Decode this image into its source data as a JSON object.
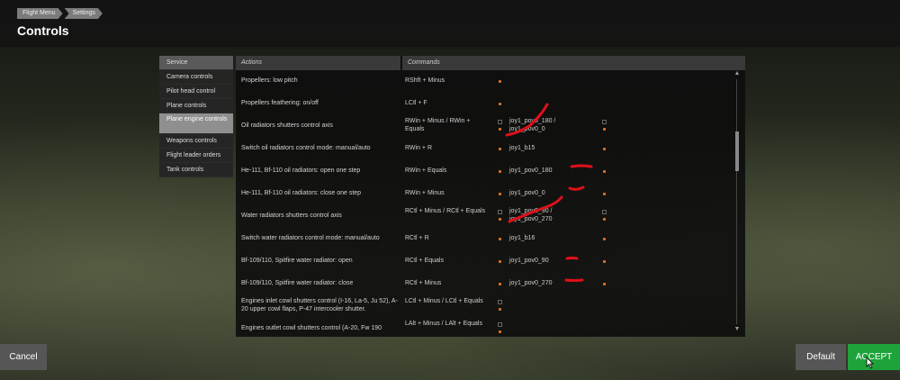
{
  "breadcrumb": [
    "Flight Menu",
    "Settings"
  ],
  "page_title": "Controls",
  "sidebar": {
    "items": [
      {
        "label": "Service"
      },
      {
        "label": "Camera controls"
      },
      {
        "label": "Pilot head control"
      },
      {
        "label": "Plane controls"
      },
      {
        "label": "Plane engine controls",
        "active": true
      },
      {
        "label": "Weapons controls"
      },
      {
        "label": "Flight leader orders"
      },
      {
        "label": "Tank controls"
      }
    ]
  },
  "table": {
    "headers": {
      "actions": "Actions",
      "commands": "Commands"
    },
    "rows": [
      {
        "action": "Propellers: low pitch",
        "key": "RShft + Minus",
        "joy": ""
      },
      {
        "action": "Propellers feathering: on/off",
        "key": "LCtl + F",
        "joy": ""
      },
      {
        "action": "Oil radiators shutters control axis",
        "key": "RWin + Minus / RWin + Equals",
        "joy": "joy1_pov0_180 / joy1_pov0_0"
      },
      {
        "action": "Switch oil radiators control mode: manual/auto",
        "key": "RWin + R",
        "joy": "joy1_b15"
      },
      {
        "action": "He-111, Bf-110 oil radiators: open one step",
        "key": "RWin + Equals",
        "joy": "joy1_pov0_180"
      },
      {
        "action": "He-111, Bf-110 oil radiators: close one step",
        "key": "RWin + Minus",
        "joy": "joy1_pov0_0"
      },
      {
        "action": "Water radiators shutters control axis",
        "key": "RCtl + Minus / RCtl + Equals",
        "joy": "joy1_pov0_90 / joy1_pov0_270"
      },
      {
        "action": "Switch water radiators control mode: manual/auto",
        "key": "RCtl + R",
        "joy": "joy1_b16"
      },
      {
        "action": "Bf-109/110, Spitfire water radiator: open",
        "key": "RCtl + Equals",
        "joy": "joy1_pov0_90"
      },
      {
        "action": "Bf-109/110, Spitfire water radiator: close",
        "key": "RCtl + Minus",
        "joy": "joy1_pov0_270"
      },
      {
        "action": "Engines inlet cowl shutters control (I-16, La-5, Ju 52), A-20 upper cowl flaps, P-47 intercooler shutter.",
        "key": "LCtl + Minus / LCtl + Equals",
        "joy": ""
      },
      {
        "action": "Engines outlet cowl shutters control (A-20, Fw 190",
        "key": "LAlt + Minus / LAlt + Equals",
        "joy": ""
      }
    ]
  },
  "buttons": {
    "cancel": "Cancel",
    "default": "Default",
    "accept": "ACCEPT"
  },
  "colors": {
    "accept": "#1ea33a",
    "annotation": "#e0101a",
    "indicator": "#e07320"
  },
  "icons": {
    "scroll_up": "▲",
    "scroll_down": "▼"
  }
}
